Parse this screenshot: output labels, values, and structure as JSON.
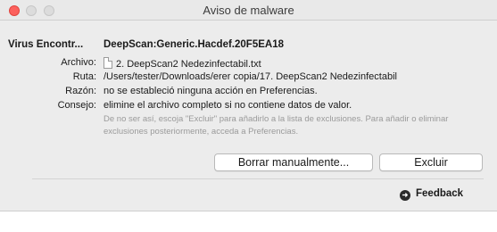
{
  "window": {
    "title": "Aviso de malware"
  },
  "virus": {
    "label": "Virus Encontr...",
    "value": "DeepScan:Generic.Hacdef.20F5EA18"
  },
  "details": {
    "archivo_label": "Archivo:",
    "archivo_value": "2. DeepScan2 Nedezinfectabil.txt",
    "ruta_label": "Ruta:",
    "ruta_value": "/Users/tester/Downloads/erer copia/17. DeepScan2 Nedezinfectabil",
    "razon_label": "Razón:",
    "razon_value": "no se estableció ninguna acción en Preferencias.",
    "consejo_label": "Consejo:",
    "consejo_value": "elimine el archivo completo si no contiene datos de valor.",
    "note": "De no ser así, escoja \"Excluir\" para añadirlo a la lista de exclusiones. Para añadir o eliminar exclusiones posteriormente, acceda a Preferencias."
  },
  "buttons": {
    "borrar": "Borrar manualmente...",
    "excluir": "Excluir"
  },
  "footer": {
    "feedback": "Feedback"
  },
  "icons": {
    "file": "file-icon",
    "feedback": "arrow-circle-icon"
  },
  "colors": {
    "close": "#fc605c",
    "background": "#ececec"
  }
}
